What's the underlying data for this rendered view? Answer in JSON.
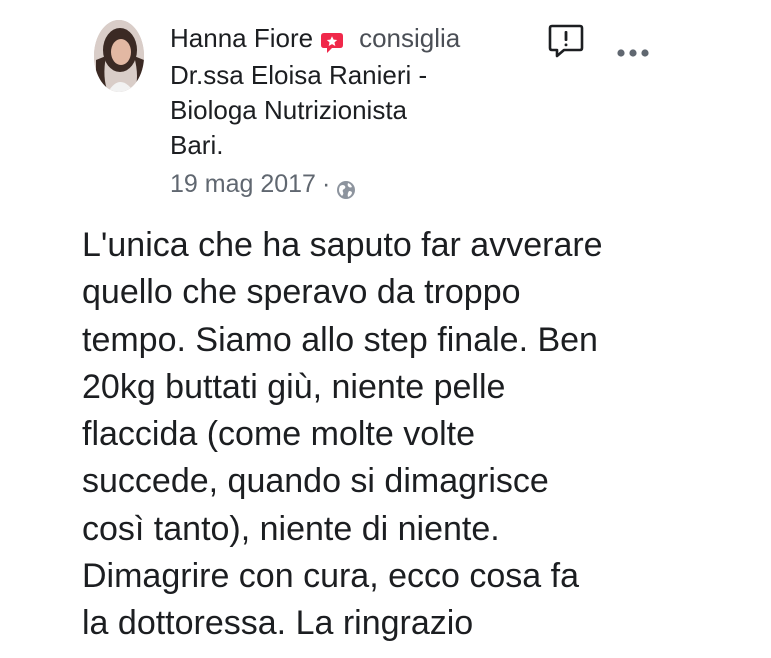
{
  "post": {
    "author": "Hanna Fiore",
    "verb": "consiglia",
    "page_lines": [
      "Dr.ssa Eloisa Ranieri -",
      "Biologa Nutrizionista",
      "Bari."
    ],
    "date": "19 mag 2017",
    "separator": "·",
    "body_lines": [
      "L'unica che ha saputo far avverare",
      "quello che speravo da troppo",
      "tempo. Siamo allo step finale. Ben",
      "20kg buttati giù, niente pelle",
      "flaccida (come molte volte",
      "succede, quando si dimagrisce",
      "così tanto), niente di niente.",
      "Dimagrire con cura, ecco cosa fa",
      "la dottoressa. La ringrazio"
    ],
    "icons": {
      "recommend": "recommendation-badge-icon",
      "privacy": "globe-icon",
      "report": "report-icon",
      "more": "more-options-icon"
    },
    "colors": {
      "recommend_badge": "#f0284a",
      "text": "#1c1e21",
      "secondary_text": "#606770"
    }
  }
}
